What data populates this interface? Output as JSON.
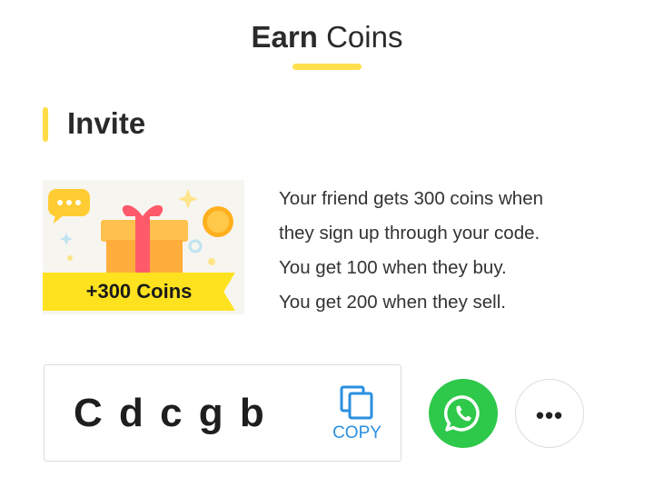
{
  "header": {
    "title_bold": "Earn",
    "title_rest": " Coins"
  },
  "section": {
    "title": "Invite"
  },
  "promo": {
    "label": "+300 Coins",
    "icon": "gift-box-icon"
  },
  "description": {
    "lines": [
      "Your friend gets 300 coins when",
      "they sign up through your code.",
      "You get 100 when they buy.",
      "You get 200 when they sell."
    ]
  },
  "invite_code": {
    "value": "C d c g b",
    "copy_label": "COPY"
  },
  "share": {
    "whatsapp_icon": "whatsapp-icon",
    "more_icon": "more-dots-icon",
    "more_glyph": "•••"
  },
  "colors": {
    "accent_yellow": "#ffe04d",
    "whatsapp_green": "#2ec84a",
    "copy_blue": "#2a8fe0"
  }
}
